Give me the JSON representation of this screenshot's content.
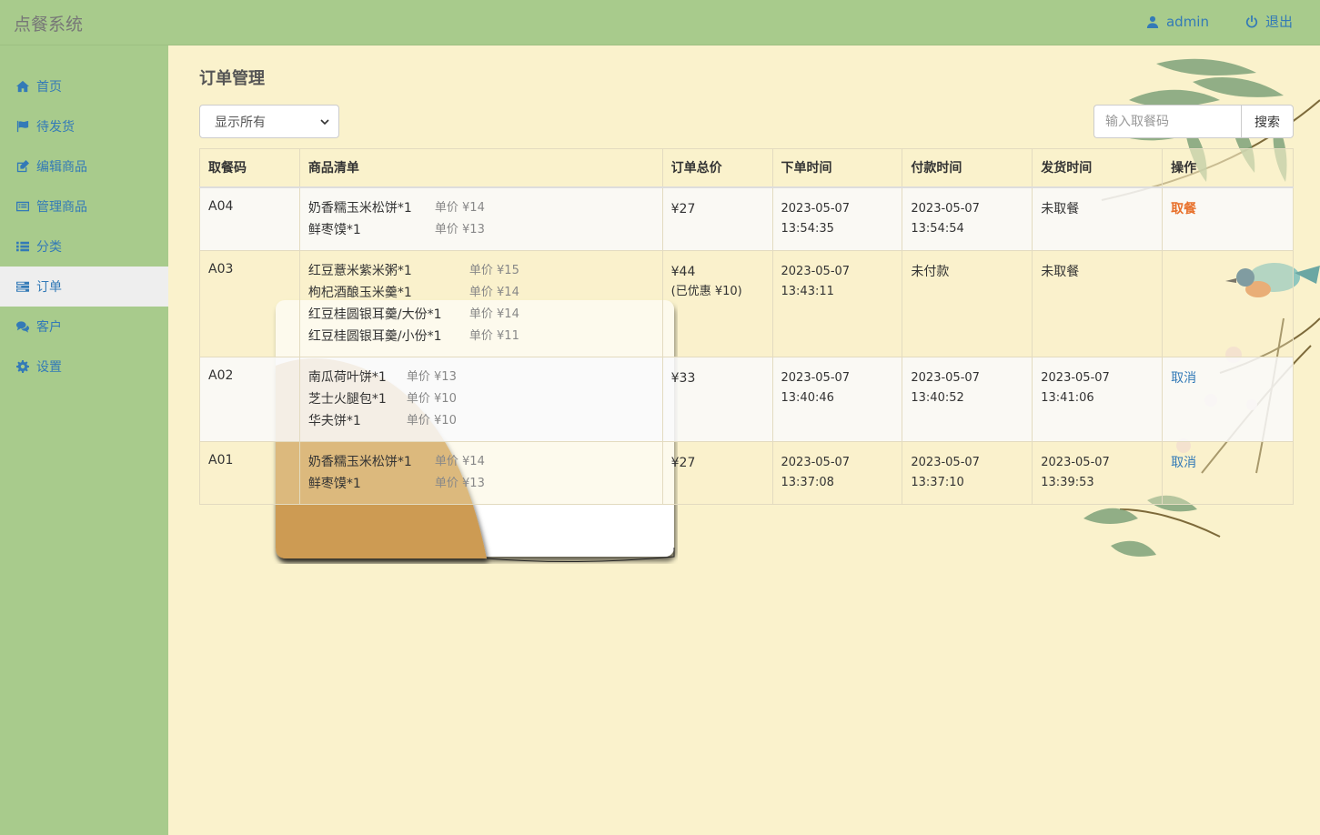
{
  "app": {
    "title": "点餐系统"
  },
  "header": {
    "user": "admin",
    "logout": "退出"
  },
  "sidebar": {
    "items": [
      {
        "label": "首页",
        "icon": "home-icon"
      },
      {
        "label": "待发货",
        "icon": "flag-icon"
      },
      {
        "label": "编辑商品",
        "icon": "edit-icon"
      },
      {
        "label": "管理商品",
        "icon": "list-alt-icon"
      },
      {
        "label": "分类",
        "icon": "list-icon"
      },
      {
        "label": "订单",
        "icon": "tasks-icon",
        "active": true
      },
      {
        "label": "客户",
        "icon": "comments-icon"
      },
      {
        "label": "设置",
        "icon": "gear-icon"
      }
    ]
  },
  "page": {
    "title": "订单管理",
    "filter": {
      "selected": "显示所有"
    },
    "search": {
      "placeholder": "输入取餐码",
      "button": "搜索"
    }
  },
  "table": {
    "headers": [
      "取餐码",
      "商品清单",
      "订单总价",
      "下单时间",
      "付款时间",
      "发货时间",
      "操作"
    ],
    "rows": [
      {
        "code": "A04",
        "items": [
          {
            "name": "奶香糯玉米松饼*1",
            "price": "单价 ¥14"
          },
          {
            "name": "鲜枣馍*1",
            "price": "单价 ¥13"
          }
        ],
        "total": "¥27",
        "discount": "",
        "order_date": "2023-05-07",
        "order_time": "13:54:35",
        "pay_date": "2023-05-07",
        "pay_time": "13:54:54",
        "ship_date": "未取餐",
        "ship_time": "",
        "action": "取餐"
      },
      {
        "code": "A03",
        "items": [
          {
            "name": "红豆薏米紫米粥*1",
            "price": "单价 ¥15"
          },
          {
            "name": "枸杞酒酿玉米羹*1",
            "price": "单价 ¥14"
          },
          {
            "name": "红豆桂圆银耳羹/大份*1",
            "price": "单价 ¥14"
          },
          {
            "name": "红豆桂圆银耳羹/小份*1",
            "price": "单价 ¥11"
          }
        ],
        "total": "¥44",
        "discount": "(已优惠 ¥10)",
        "order_date": "2023-05-07",
        "order_time": "13:43:11",
        "pay_date": "未付款",
        "pay_time": "",
        "ship_date": "未取餐",
        "ship_time": "",
        "action": ""
      },
      {
        "code": "A02",
        "items": [
          {
            "name": "南瓜荷叶饼*1",
            "price": "单价 ¥13"
          },
          {
            "name": "芝士火腿包*1",
            "price": "单价 ¥10"
          },
          {
            "name": "华夫饼*1",
            "price": "单价 ¥10"
          }
        ],
        "total": "¥33",
        "discount": "",
        "order_date": "2023-05-07",
        "order_time": "13:40:46",
        "pay_date": "2023-05-07",
        "pay_time": "13:40:52",
        "ship_date": "2023-05-07",
        "ship_time": "13:41:06",
        "action": "取消"
      },
      {
        "code": "A01",
        "items": [
          {
            "name": "奶香糯玉米松饼*1",
            "price": "单价 ¥14"
          },
          {
            "name": "鲜枣馍*1",
            "price": "单价 ¥13"
          }
        ],
        "total": "¥27",
        "discount": "",
        "order_date": "2023-05-07",
        "order_time": "13:37:08",
        "pay_date": "2023-05-07",
        "pay_time": "13:37:10",
        "ship_date": "2023-05-07",
        "ship_time": "13:39:53",
        "action": "取消"
      }
    ]
  },
  "colors": {
    "sidebar_bg": "#a8cb8c",
    "page_bg": "#faf2cc",
    "link": "#337ab7",
    "take_action": "#e8702a"
  }
}
